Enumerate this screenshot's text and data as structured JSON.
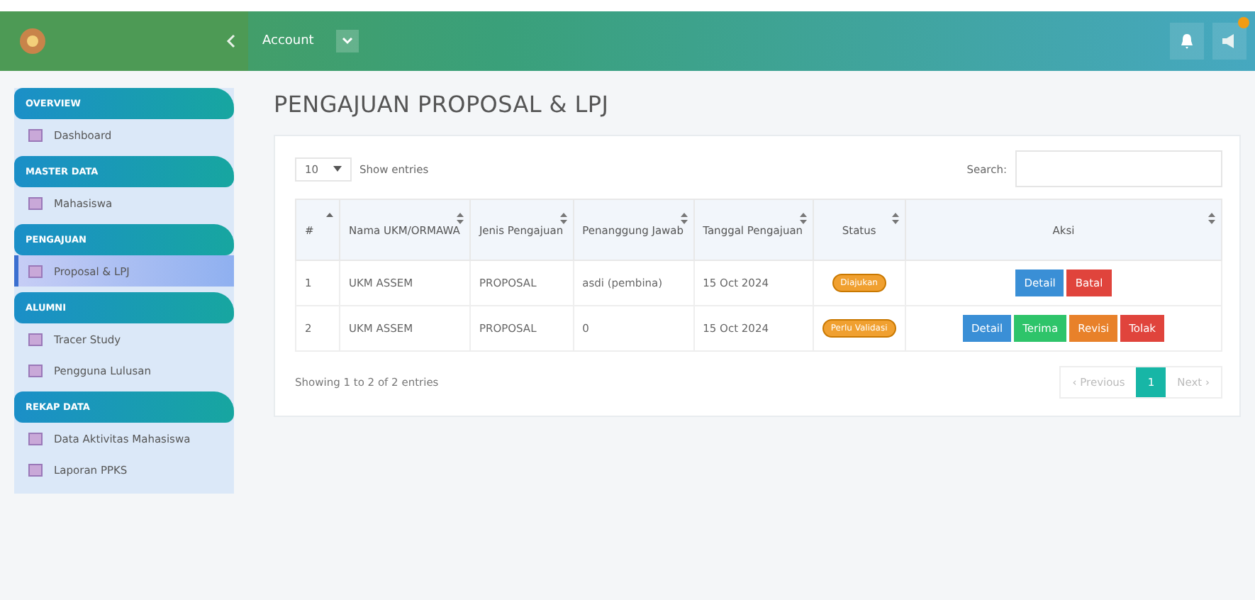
{
  "topbar": {
    "menu": "Account"
  },
  "sidebar": {
    "sections": [
      {
        "title": "OVERVIEW",
        "items": [
          {
            "label": "Dashboard",
            "selected": false
          }
        ]
      },
      {
        "title": "MASTER DATA",
        "items": [
          {
            "label": "Mahasiswa",
            "selected": false
          }
        ]
      },
      {
        "title": "PENGAJUAN",
        "items": [
          {
            "label": "Proposal & LPJ",
            "selected": true
          }
        ]
      },
      {
        "title": "ALUMNI",
        "items": [
          {
            "label": "Tracer Study",
            "selected": false
          },
          {
            "label": "Pengguna Lulusan",
            "selected": false
          }
        ]
      },
      {
        "title": "REKAP DATA",
        "items": [
          {
            "label": "Data Aktivitas Mahasiswa",
            "selected": false
          },
          {
            "label": "Laporan PPKS",
            "selected": false
          }
        ]
      }
    ]
  },
  "page": {
    "title": "PENGAJUAN PROPOSAL & LPJ",
    "entries": {
      "value": "10",
      "label": "Show entries"
    },
    "search": {
      "label": "Search:"
    },
    "table": {
      "columns": [
        {
          "label": "#",
          "sorted": true
        },
        {
          "label": "Nama UKM/ORMAWA",
          "sorted": false
        },
        {
          "label": "Jenis Pengajuan",
          "sorted": false
        },
        {
          "label": "Penanggung Jawab",
          "sorted": false
        },
        {
          "label": "Tanggal Pengajuan",
          "sorted": false
        },
        {
          "label": "Status",
          "sorted": false
        },
        {
          "label": "Aksi",
          "sorted": false
        }
      ],
      "rows": [
        {
          "cells": [
            "1",
            "UKM ASSEM",
            "PROPOSAL",
            "asdi (pembina)",
            "15 Oct 2024"
          ],
          "status": {
            "text": "Diajukan",
            "color": "#f0a030"
          },
          "actions": [
            {
              "label": "Detail",
              "color": "#3a8fd6"
            },
            {
              "label": "Batal",
              "color": "#e0443c"
            }
          ]
        },
        {
          "cells": [
            "2",
            "UKM ASSEM",
            "PROPOSAL",
            "0",
            "15 Oct 2024"
          ],
          "status": {
            "text": "Perlu Validasi",
            "color": "#f0a030"
          },
          "actions": [
            {
              "label": "Detail",
              "color": "#3a8fd6"
            },
            {
              "label": "Terima",
              "color": "#2ec46a"
            },
            {
              "label": "Revisi",
              "color": "#e8812a"
            },
            {
              "label": "Tolak",
              "color": "#e0443c"
            }
          ]
        }
      ]
    },
    "info": "Showing 1 to 2 of 2 entries",
    "pagination": [
      {
        "label": "‹ Previous",
        "selected": false,
        "disabled": true
      },
      {
        "label": "1",
        "selected": true,
        "disabled": false
      },
      {
        "label": "Next ›",
        "selected": false,
        "disabled": true
      }
    ]
  }
}
